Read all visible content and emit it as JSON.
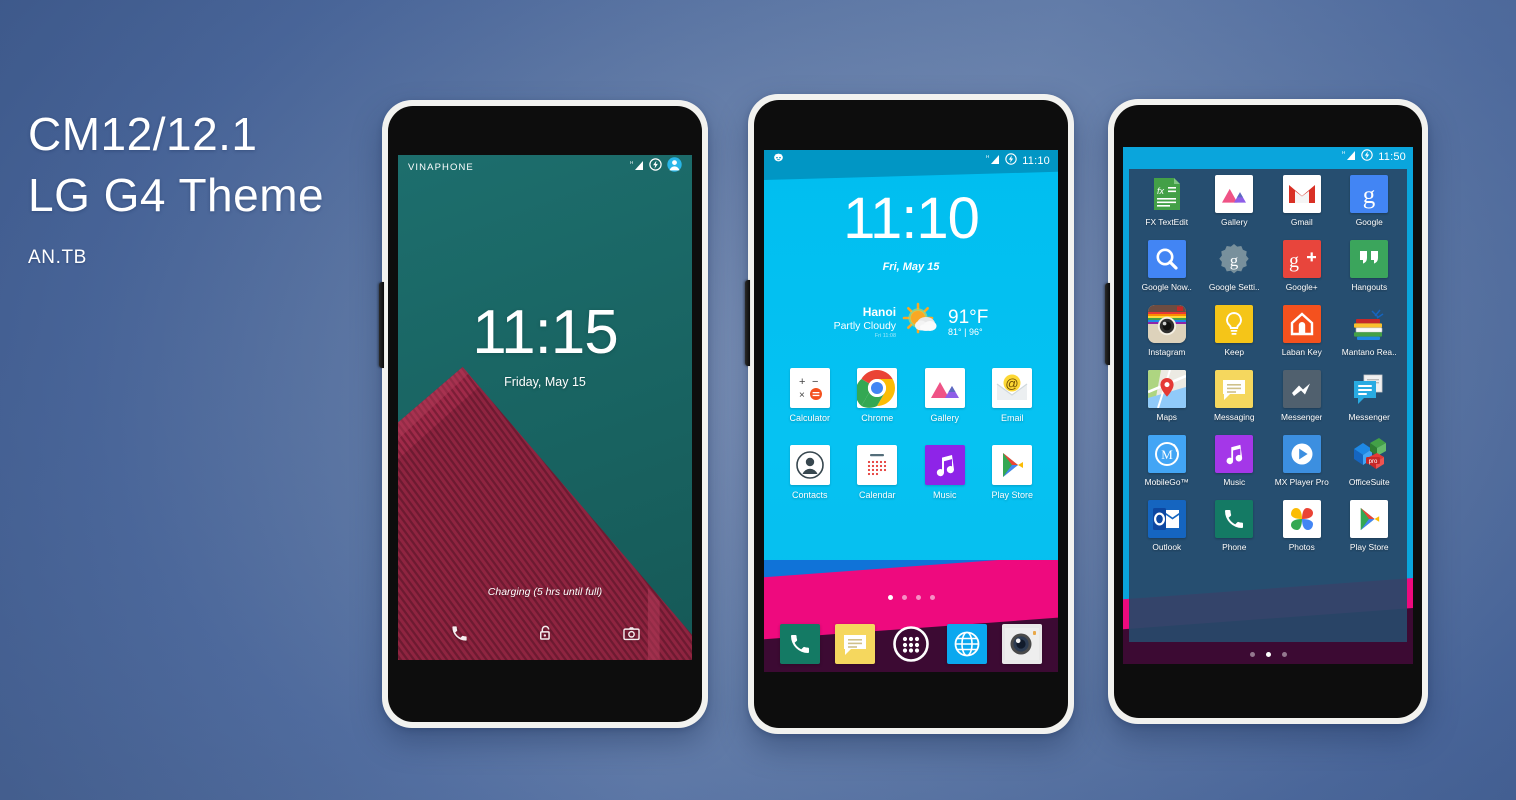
{
  "headline": {
    "line1": "CM12/12.1",
    "line2": "LG G4  Theme",
    "author": "AN.TB"
  },
  "colors": {
    "background_top": "#4a6ba5",
    "background_mid": "#7e93b9",
    "lockscreen_teal": "#1a6b6b",
    "lockscreen_maroon": "#8f2440",
    "home_cyan": "#06c2f2",
    "accent_pink": "#ee0a7e",
    "accent_plum": "#3c0a33",
    "statusbar_blue": "#0aa5dc",
    "drawer_panel": "#28486 9"
  },
  "phone1": {
    "name": "lock-screen-phone",
    "statusbar": {
      "carrier": "VINAPHONE",
      "signal_label": "H",
      "icons": [
        "signal-icon",
        "charging-icon",
        "account-avatar-icon"
      ]
    },
    "clock": "11:15",
    "date": "Friday, May 15",
    "charging_text": "Charging (5 hrs until full)",
    "actions": [
      "phone-icon",
      "unlock-icon",
      "camera-icon"
    ]
  },
  "phone2": {
    "name": "home-screen-phone",
    "statusbar": {
      "notification_icon": "cyanogenmod-icon",
      "signal_label": "H",
      "icons": [
        "signal-icon",
        "charging-icon"
      ],
      "time": "11:10"
    },
    "clock": "11:10",
    "date": "Fri, May 15",
    "weather": {
      "city": "Hanoi",
      "condition": "Partly Cloudy",
      "updated": "Fri 11:08",
      "temp": "91°F",
      "high_low": "81° | 96°",
      "icon": "partly-cloudy-icon"
    },
    "apps": [
      {
        "label": "Calculator",
        "icon": "calculator-icon"
      },
      {
        "label": "Chrome",
        "icon": "chrome-icon"
      },
      {
        "label": "Gallery",
        "icon": "gallery-icon"
      },
      {
        "label": "Email",
        "icon": "email-icon"
      },
      {
        "label": "Contacts",
        "icon": "contacts-icon"
      },
      {
        "label": "Calendar",
        "icon": "calendar-icon"
      },
      {
        "label": "Music",
        "icon": "music-icon"
      },
      {
        "label": "Play Store",
        "icon": "play-store-icon"
      }
    ],
    "page_dots": {
      "count": 4,
      "active": 0
    },
    "dock": [
      {
        "label": "Phone",
        "icon": "phone-icon"
      },
      {
        "label": "Messaging",
        "icon": "messaging-icon"
      },
      {
        "label": "All apps",
        "icon": "app-drawer-icon"
      },
      {
        "label": "Browser",
        "icon": "browser-globe-icon"
      },
      {
        "label": "Camera",
        "icon": "camera-icon"
      }
    ]
  },
  "phone3": {
    "name": "app-drawer-phone",
    "statusbar": {
      "signal_label": "H",
      "icons": [
        "signal-icon",
        "charging-icon"
      ],
      "time": "11:50"
    },
    "apps": [
      {
        "label": "FX TextEdit",
        "icon": "fx-textedit-icon"
      },
      {
        "label": "Gallery",
        "icon": "gallery-icon"
      },
      {
        "label": "Gmail",
        "icon": "gmail-icon"
      },
      {
        "label": "Google",
        "icon": "google-icon"
      },
      {
        "label": "Google Now..",
        "icon": "google-now-icon"
      },
      {
        "label": "Google Setti..",
        "icon": "google-settings-icon"
      },
      {
        "label": "Google+",
        "icon": "google-plus-icon"
      },
      {
        "label": "Hangouts",
        "icon": "hangouts-icon"
      },
      {
        "label": "Instagram",
        "icon": "instagram-icon"
      },
      {
        "label": "Keep",
        "icon": "keep-icon"
      },
      {
        "label": "Laban Key",
        "icon": "laban-key-icon"
      },
      {
        "label": "Mantano Rea..",
        "icon": "mantano-reader-icon"
      },
      {
        "label": "Maps",
        "icon": "maps-icon"
      },
      {
        "label": "Messaging",
        "icon": "messaging-icon"
      },
      {
        "label": "Messenger",
        "icon": "facebook-messenger-icon"
      },
      {
        "label": "Messenger",
        "icon": "messenger-blue-icon"
      },
      {
        "label": "MobileGo™",
        "icon": "mobilego-icon"
      },
      {
        "label": "Music",
        "icon": "music-icon"
      },
      {
        "label": "MX Player Pro",
        "icon": "mx-player-icon"
      },
      {
        "label": "OfficeSuite",
        "icon": "officesuite-icon"
      },
      {
        "label": "Outlook",
        "icon": "outlook-icon"
      },
      {
        "label": "Phone",
        "icon": "phone-icon"
      },
      {
        "label": "Photos",
        "icon": "google-photos-icon"
      },
      {
        "label": "Play Store",
        "icon": "play-store-icon"
      }
    ],
    "page_dots": {
      "count": 3,
      "active": 1
    }
  }
}
